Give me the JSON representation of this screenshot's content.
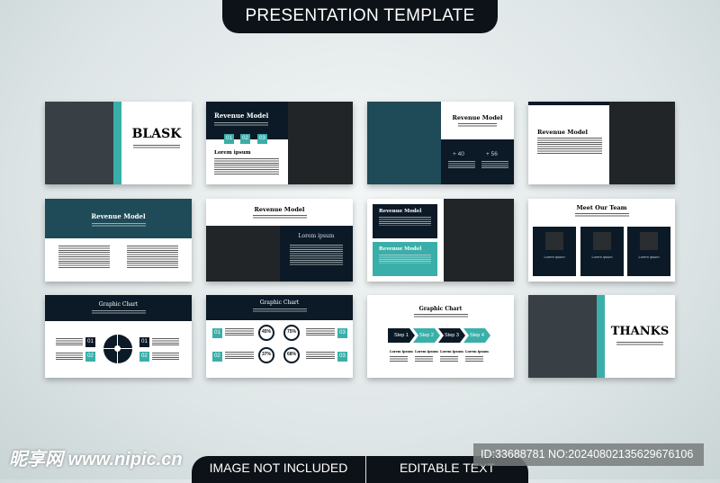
{
  "header": {
    "title": "PRESENTATION TEMPLATE"
  },
  "colors": {
    "navy": "#0b1a26",
    "teal": "#3aafa9",
    "dark_teal": "#1f4a57",
    "slate": "#383f45",
    "charcoal": "#222528"
  },
  "slides": {
    "s1": {
      "title": "BLASK"
    },
    "s2": {
      "title": "Revenue Model",
      "boxes": [
        "01",
        "02",
        "03"
      ],
      "subtitle": "Lorem ipsum"
    },
    "s3": {
      "title": "Revenue Model",
      "stats": [
        "+ 40",
        "+ 56"
      ]
    },
    "s4": {
      "title": "Revenue Model"
    },
    "s5": {
      "title": "Revenue Model"
    },
    "s6": {
      "title": "Revenue Model",
      "subtitle": "Lorem ipsum"
    },
    "s7": {
      "title_a": "Revenue Model",
      "title_b": "Revenue Model"
    },
    "s8": {
      "title": "Meet Our Team",
      "members": [
        "Lorem ipsum",
        "Lorem ipsum",
        "Lorem ipsum"
      ]
    },
    "s9": {
      "title": "Graphic Chart",
      "labels": [
        "01",
        "02",
        "01",
        "02"
      ]
    },
    "s10": {
      "title": "Graphic Chart",
      "percents": [
        "45%",
        "75%",
        "37%",
        "68%"
      ],
      "labels": [
        "01",
        "02",
        "03",
        "03"
      ]
    },
    "s11": {
      "title": "Graphic Chart",
      "steps": [
        "Step 1",
        "Step 2",
        "Step 3",
        "Step 4"
      ],
      "captions": [
        "Lorem ipsum",
        "Lorem ipsum",
        "Lorem ipsum",
        "Lorem ipsum"
      ]
    },
    "s12": {
      "title": "THANKS"
    }
  },
  "footer": {
    "left": "IMAGE NOT INCLUDED",
    "right": "EDITABLE TEXT"
  },
  "watermark": {
    "logo": "昵享网 www.nipic.cn",
    "id": "ID:33688781 NO:20240802135629676106"
  }
}
